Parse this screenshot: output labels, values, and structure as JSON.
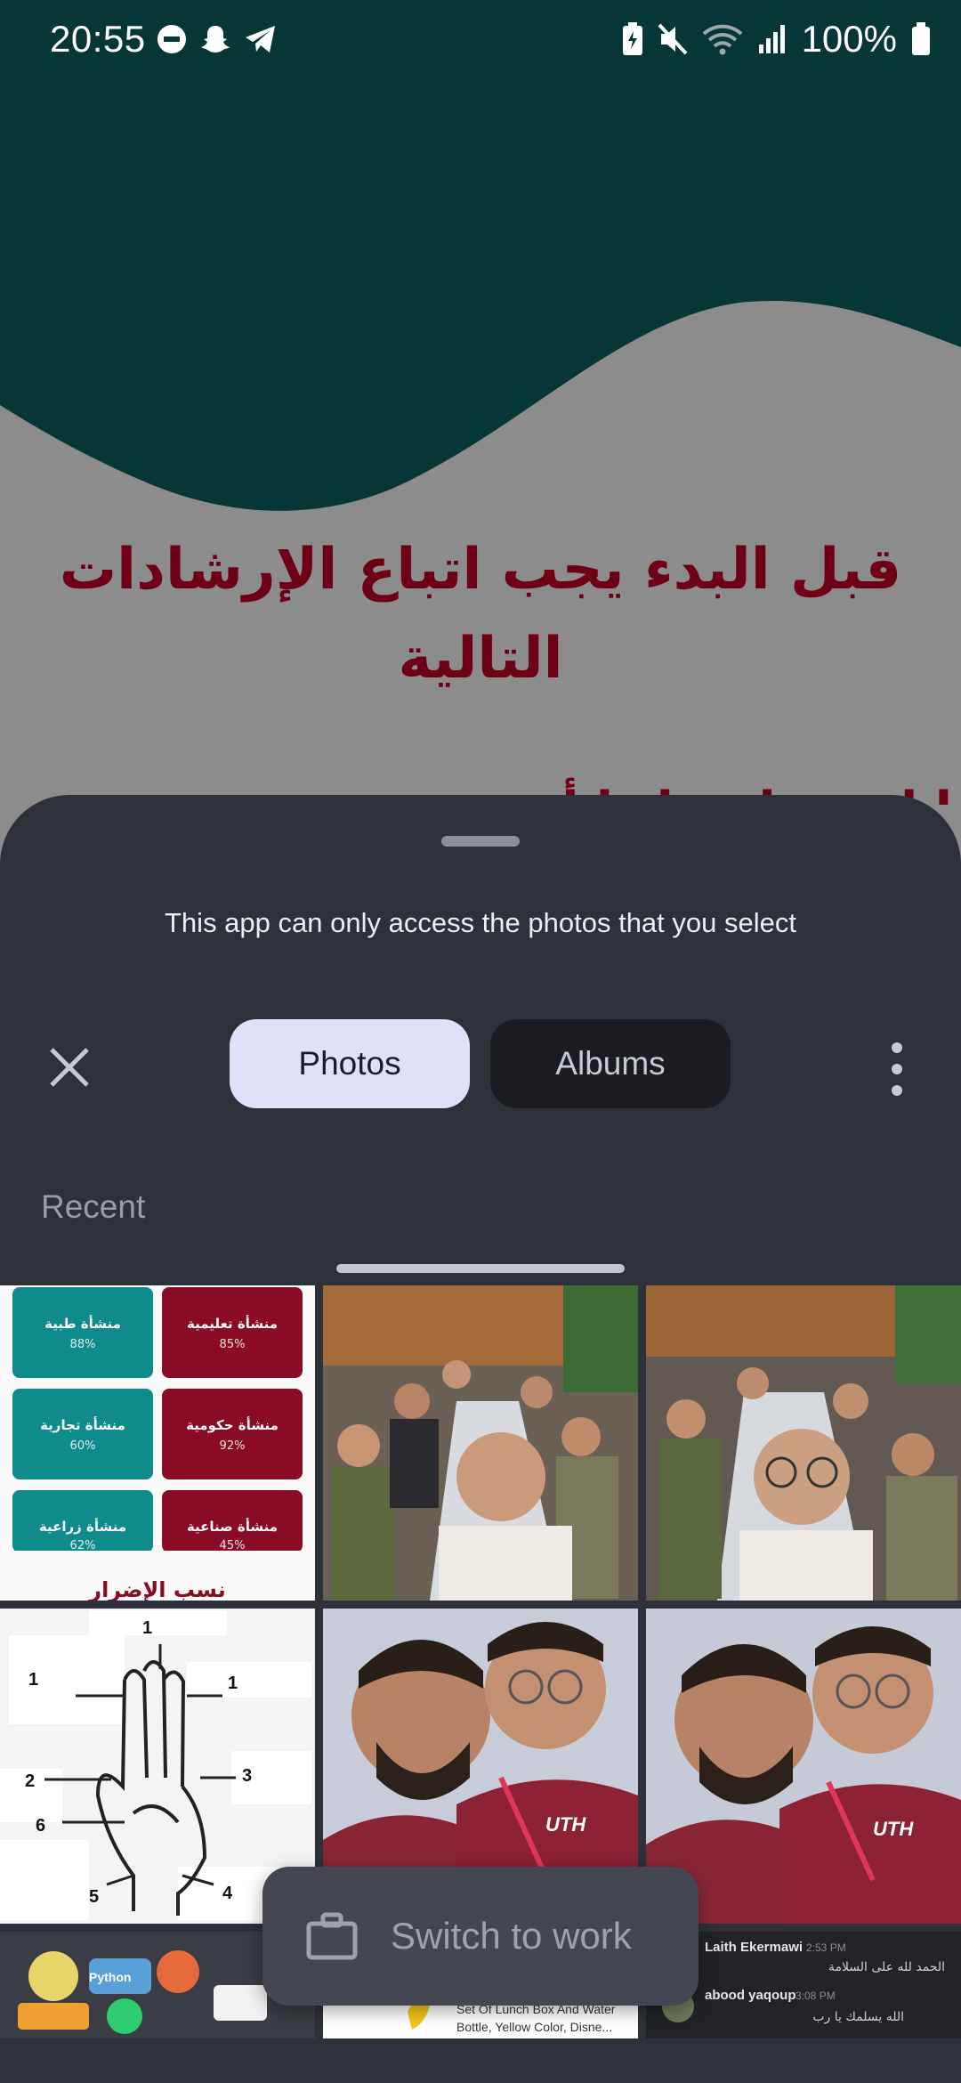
{
  "status_bar": {
    "time": "20:55",
    "left_icons": [
      "do-not-disturb-icon",
      "snapchat-icon",
      "telegram-icon"
    ],
    "right_icons": [
      "battery-saver-icon",
      "mute-icon",
      "wifi-icon",
      "signal-icon",
      "battery-icon"
    ],
    "battery": "100%"
  },
  "background_app": {
    "heading": "قبل البدء يجب اتباع الإرشادات التالية",
    "partial_text": "ا  لب ح ا ب ل ا أ ي",
    "colors": {
      "wave": "#073636",
      "background": "#8c8c8c",
      "heading": "#6e0016"
    }
  },
  "sheet": {
    "message": "This app can only access the photos that you select",
    "tabs": [
      {
        "label": "Photos",
        "selected": true
      },
      {
        "label": "Albums",
        "selected": false
      }
    ],
    "section_label": "Recent",
    "close_icon": "close-icon",
    "more_icon": "more-vert-icon",
    "switch_work_label": "Switch to work",
    "switch_work_icon": "briefcase-icon",
    "colors": {
      "sheet": "#2e303a",
      "tab_selected": "#e1e0fb",
      "tab_unselected": "#1b1c22"
    }
  },
  "photos": {
    "stats_tiles": [
      {
        "label": "منشأة طبية",
        "value": "88%"
      },
      {
        "label": "منشأة تعليمية",
        "value": "85%"
      },
      {
        "label": "منشأة تجارية",
        "value": "60%"
      },
      {
        "label": "منشأة حكومية",
        "value": "92%"
      },
      {
        "label": "منشأة زراعية",
        "value": "62%"
      },
      {
        "label": "منشأة صناعية",
        "value": "45%"
      }
    ],
    "stats_caption": "نسب الإضرار",
    "hand_diagram_labels": [
      "1",
      "1",
      "1",
      "2",
      "3",
      "6",
      "5",
      "4"
    ],
    "product_caption": "Set Of Lunch Box And Water Bottle, Yellow Color, Disne...",
    "chat": [
      {
        "name": "Laith Ekermawi",
        "time": "2:53 PM",
        "text": "الحمد لله على السلامة"
      },
      {
        "name": "abood yaqoup",
        "time": "3:08 PM",
        "text": "الله يسلمك يا رب"
      }
    ]
  }
}
